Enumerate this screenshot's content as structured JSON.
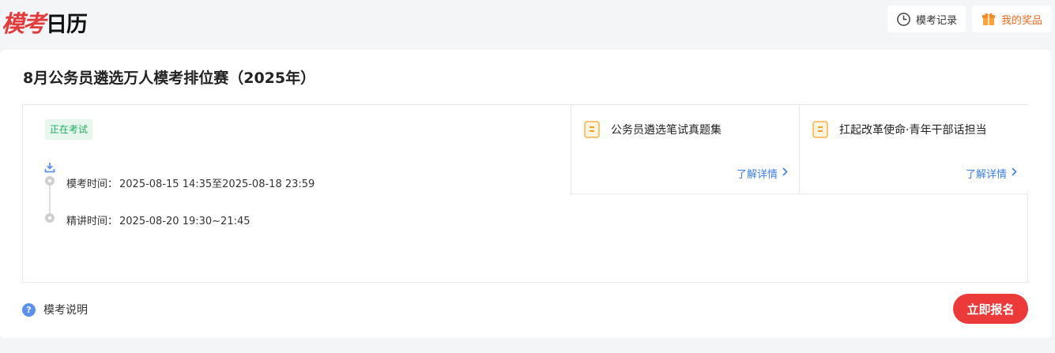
{
  "header": {
    "logo": {
      "red_text": "模考",
      "black_text": "日历"
    },
    "records_label": "模考记录",
    "prizes_label": "我的奖品"
  },
  "exam": {
    "title": "8月公务员遴选万人模考排位赛（2025年）",
    "status": "正在考试",
    "timeline": [
      {
        "label": "模考时间：",
        "value": "2025-08-15 14:35至2025-08-18 23:59"
      },
      {
        "label": "精讲时间：",
        "value": "2025-08-20 19:30~21:45"
      }
    ],
    "resources": [
      {
        "name": "公务员遴选笔试真题集",
        "link": "了解详情"
      },
      {
        "name": "扛起改革使命·青年干部话担当",
        "link": "了解详情"
      }
    ]
  },
  "footer": {
    "help_label": "模考说明",
    "signup_label": "立即报名"
  },
  "colors": {
    "brand_red": "#ec3a3a",
    "status_green": "#1fae5d",
    "link_blue": "#3b7ee6",
    "prize_orange": "#ee6a1f"
  }
}
